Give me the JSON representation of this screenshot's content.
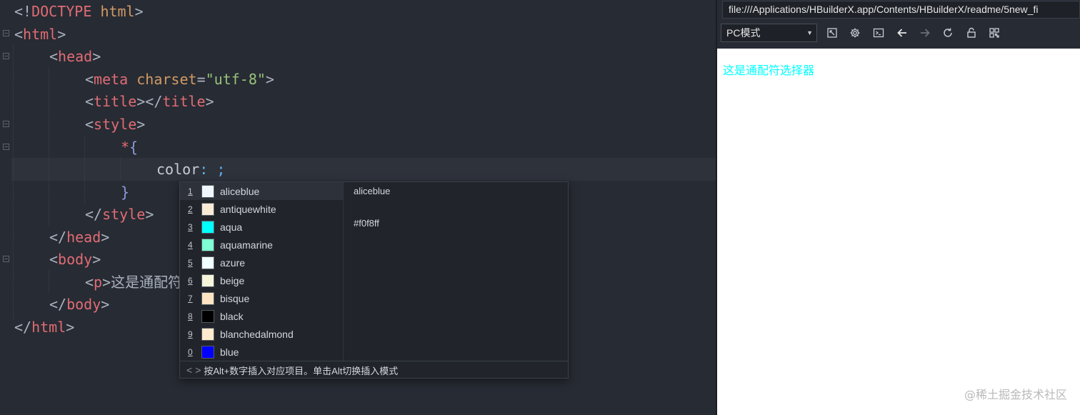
{
  "editor": {
    "lines": {
      "doctype": {
        "open": "<!",
        "keyword": "DOCTYPE",
        "name": "html",
        "close": ">"
      },
      "html_open": {
        "tag": "html"
      },
      "head_open": {
        "tag": "head"
      },
      "meta": {
        "tag": "meta",
        "attr": "charset",
        "eq": "=",
        "value": "\"utf-8\""
      },
      "title": {
        "tag": "title"
      },
      "style_open": {
        "tag": "style"
      },
      "selector": {
        "star": "*",
        "brace": "{"
      },
      "declaration": {
        "property": "color",
        "colon": ":",
        "semicolon": ";"
      },
      "brace_close": "}",
      "style_close": {
        "tag": "style"
      },
      "head_close": {
        "tag": "head"
      },
      "body_open": {
        "tag": "body"
      },
      "p_line": {
        "tag": "p",
        "text": "这是通配符"
      },
      "body_close": {
        "tag": "body"
      },
      "html_close": {
        "tag": "html"
      }
    }
  },
  "autocomplete": {
    "items": [
      {
        "key": "1",
        "name": "aliceblue",
        "color": "#f0f8ff"
      },
      {
        "key": "2",
        "name": "antiquewhite",
        "color": "#faebd7"
      },
      {
        "key": "3",
        "name": "aqua",
        "color": "#00ffff"
      },
      {
        "key": "4",
        "name": "aquamarine",
        "color": "#7fffd4"
      },
      {
        "key": "5",
        "name": "azure",
        "color": "#f0ffff"
      },
      {
        "key": "6",
        "name": "beige",
        "color": "#f5f5dc"
      },
      {
        "key": "7",
        "name": "bisque",
        "color": "#ffe4c4"
      },
      {
        "key": "8",
        "name": "black",
        "color": "#000000"
      },
      {
        "key": "9",
        "name": "blanchedalmond",
        "color": "#ffebcd"
      },
      {
        "key": "0",
        "name": "blue",
        "color": "#0000ff"
      }
    ],
    "selected_index": 0,
    "detail": {
      "name": "aliceblue",
      "hex": "#f0f8ff"
    },
    "footer": {
      "prev": "<",
      "next": ">",
      "hint": "按Alt+数字插入对应项目。单击Alt切换插入模式"
    }
  },
  "browser": {
    "url": "file:///Applications/HBuilderX.app/Contents/HBuilderX/readme/5new_fi",
    "mode": "PC模式",
    "tools": [
      "resize-icon",
      "settings-icon",
      "console-icon",
      "back-arrow-icon",
      "forward-arrow-icon",
      "reload-icon",
      "lock-icon",
      "qrcode-icon"
    ],
    "paragraph": "这是通配符选择器",
    "paragraph_color": "#00ffff"
  },
  "watermark": "@稀土掘金技术社区"
}
